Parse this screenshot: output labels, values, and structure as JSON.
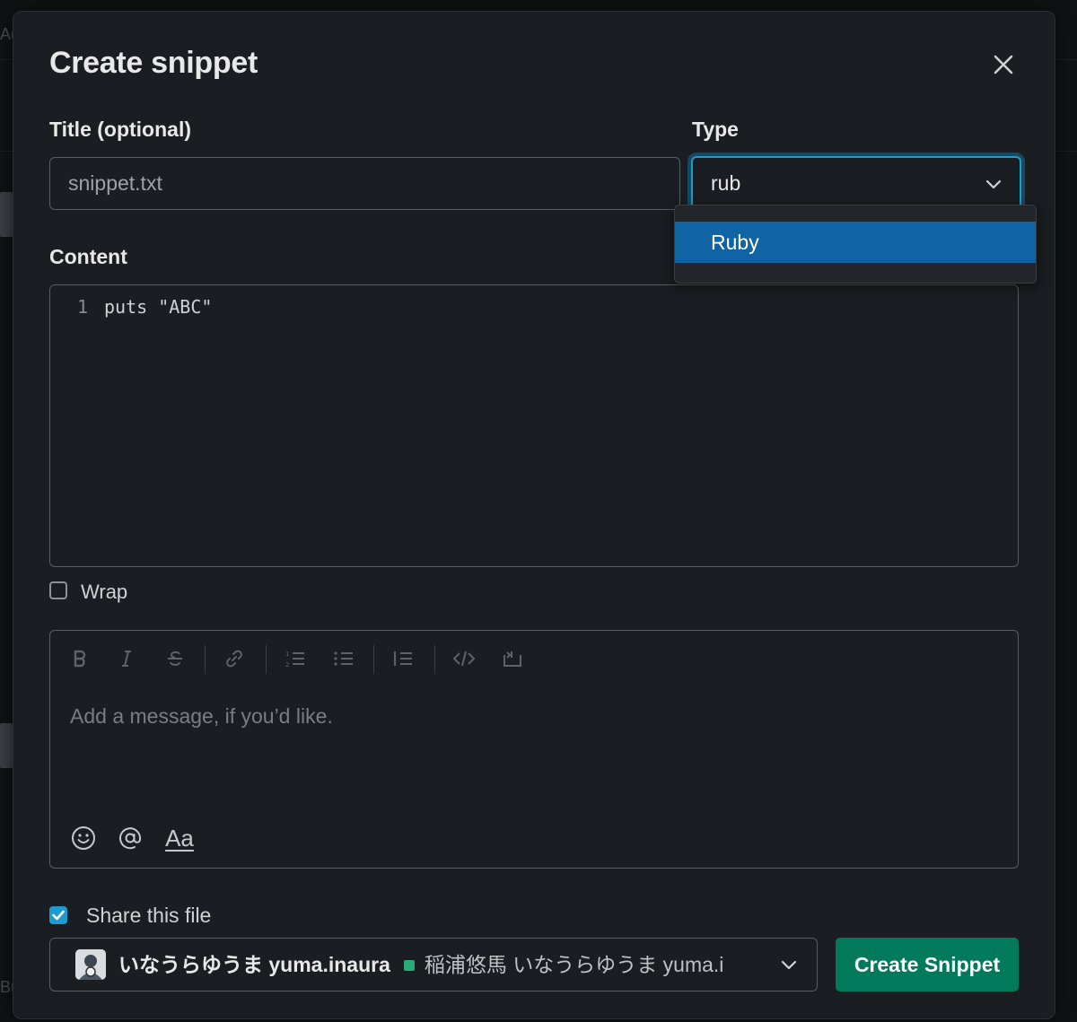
{
  "background": {
    "fragment_text": "Ac",
    "fragment_text_2": "Bu"
  },
  "modal": {
    "title": "Create snippet",
    "close_icon": "close-icon"
  },
  "title_field": {
    "label": "Title (optional)",
    "value": "snippet.txt"
  },
  "type_field": {
    "label": "Type",
    "value": "rub",
    "options": [
      "Ruby"
    ],
    "highlighted_option": "Ruby"
  },
  "content": {
    "label": "Content",
    "lines": [
      {
        "number": "1",
        "text": "puts \"ABC\""
      }
    ]
  },
  "wrap": {
    "label": "Wrap",
    "checked": false
  },
  "message": {
    "placeholder": "Add a message, if you’d like.",
    "toolbar": [
      "bold-icon",
      "italic-icon",
      "strikethrough-icon",
      "link-icon",
      "ordered-list-icon",
      "bulleted-list-icon",
      "blockquote-icon",
      "code-icon",
      "code-block-icon"
    ],
    "bottom_tools": [
      "emoji-icon",
      "mention-icon",
      "text-format-icon"
    ],
    "format_label": "Aa"
  },
  "share": {
    "label": "Share this file",
    "checked": true,
    "recipient_bold": "いなうらゆうま yuma.inaura",
    "recipient_rest": "稲浦悠馬 いなうらゆうま yuma.i"
  },
  "create_button": {
    "label": "Create Snippet"
  },
  "colors": {
    "accent": "#1d9bd1",
    "primary_button": "#007a5a",
    "option_highlight": "#1164a3"
  }
}
